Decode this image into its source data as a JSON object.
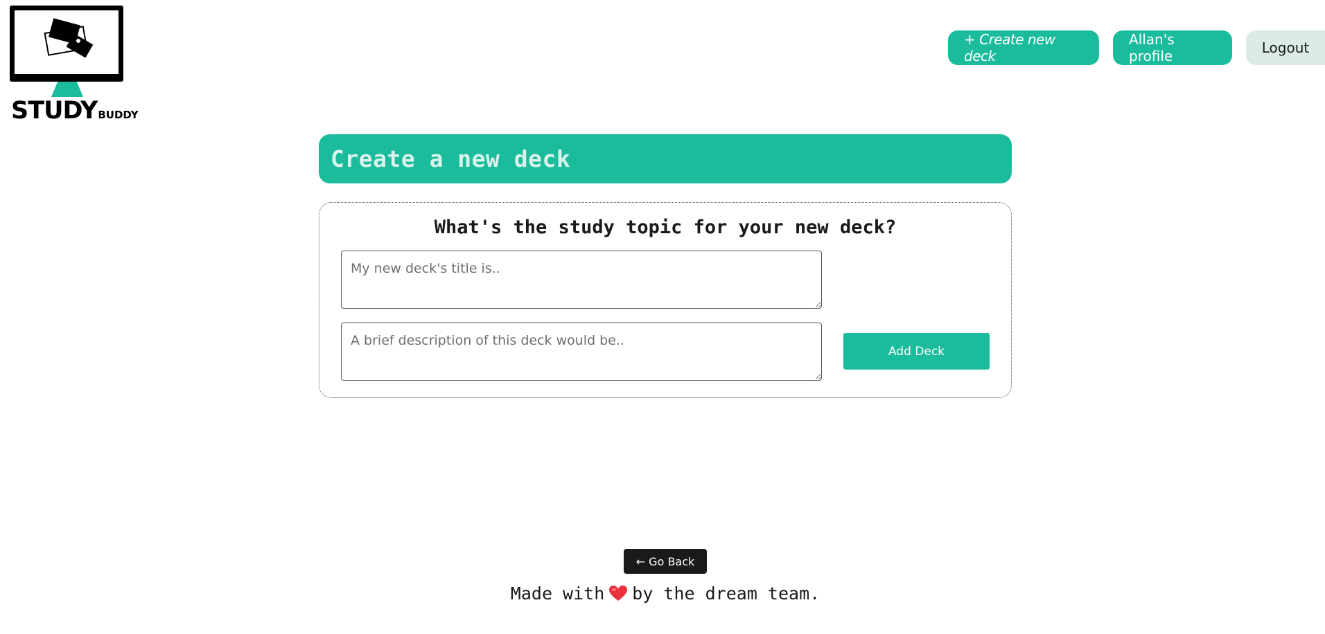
{
  "logo": {
    "text_big": "STUDY",
    "text_small": "BUDDY",
    "icon": "monitor-with-cards-icon",
    "accent": "#1abc9c"
  },
  "nav": {
    "create_label": "+ Create new deck",
    "profile_label": "Allan's profile",
    "logout_label": "Logout"
  },
  "page": {
    "title": "Create a new deck"
  },
  "form": {
    "heading": "What's the study topic for your new deck?",
    "title_placeholder": "My new deck's title is..",
    "title_value": "",
    "description_placeholder": "A brief description of this deck would be..",
    "description_value": "",
    "submit_label": "Add Deck"
  },
  "footer": {
    "back_label": "← Go Back",
    "made_with": "Made with",
    "heart_icon": "heart-icon",
    "by_team": "by the dream team."
  },
  "colors": {
    "primary": "#1abc9c",
    "secondary": "#dcebe7",
    "dark": "#1a1a1a",
    "heart": "#e8323c"
  }
}
